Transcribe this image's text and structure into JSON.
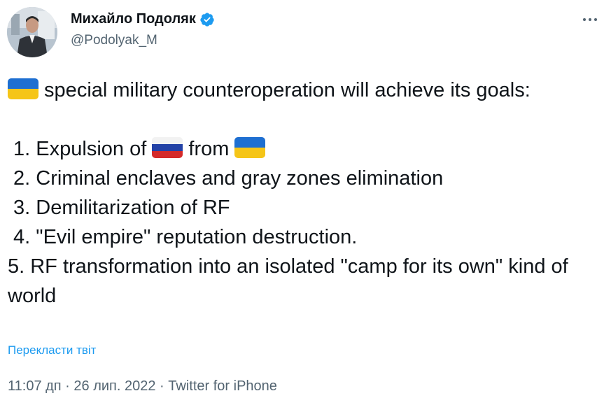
{
  "author": {
    "display_name": "Михайло Подоляк",
    "handle": "@Podolyak_M",
    "verified_icon": "verified-badge-icon",
    "avatar": "avatar-photo"
  },
  "more_icon": "more-dots-icon",
  "tweet": {
    "intro": " special military counteroperation will achieve its goals:",
    "item1_a": " 1. Expulsion of ",
    "item1_b": " from ",
    "item2": " 2. Criminal enclaves and gray zones elimination",
    "item3": " 3. Demilitarization of RF",
    "item4": " 4. \"Evil empire\" reputation destruction.",
    "item5": " 5. RF transformation into an isolated \"camp for its own\" kind of world"
  },
  "flags": {
    "ukraine": {
      "top": "#1e6fd1",
      "bottom": "#f5c518"
    },
    "russia": {
      "stripes": [
        "#f2f2f2",
        "#2342a6",
        "#d42a2a"
      ]
    }
  },
  "translate_link": "Перекласти твіт",
  "meta": {
    "time": "11:07 дп",
    "separator": " · ",
    "date": "26 лип. 2022",
    "source": "Twitter for iPhone"
  },
  "colors": {
    "text": "#0f1419",
    "secondary": "#536471",
    "accent": "#1d9bf0"
  }
}
